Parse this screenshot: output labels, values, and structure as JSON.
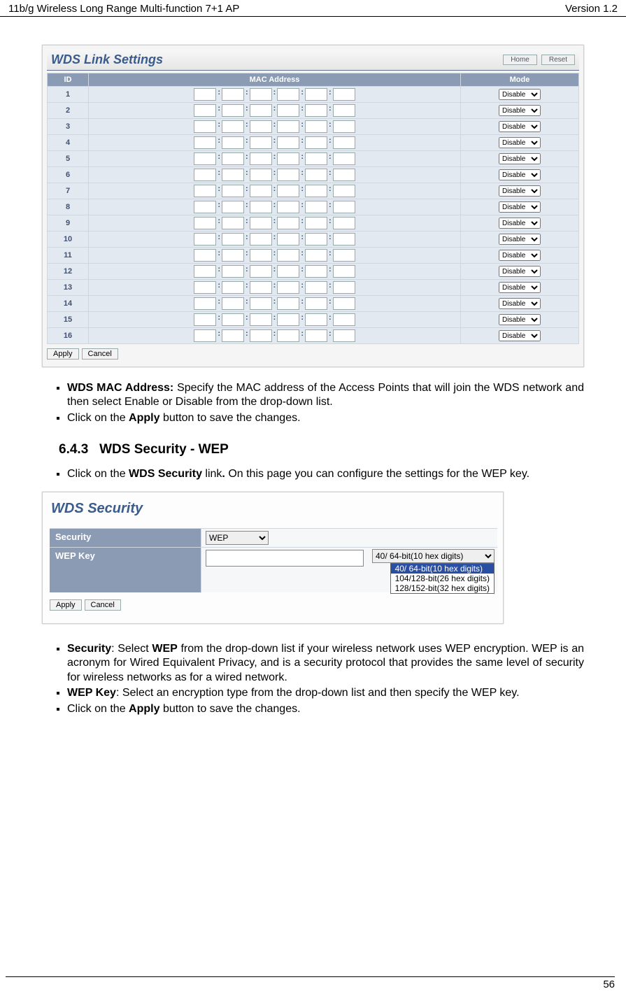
{
  "header": {
    "left": "11b/g Wireless Long Range Multi-function 7+1 AP",
    "right": "Version 1.2"
  },
  "screenshot1": {
    "title": "WDS Link Settings",
    "home": "Home",
    "reset": "Reset",
    "col_id": "ID",
    "col_mac": "MAC Address",
    "col_mode": "Mode",
    "rows": [
      "1",
      "2",
      "3",
      "4",
      "5",
      "6",
      "7",
      "8",
      "9",
      "10",
      "11",
      "12",
      "13",
      "14",
      "15",
      "16"
    ],
    "mode_value": "Disable",
    "apply": "Apply",
    "cancel": "Cancel"
  },
  "bullets1": {
    "item1_bold": "WDS MAC Address:",
    "item1_rest": " Specify the MAC address of the Access Points that will join the WDS network and then select Enable or Disable from the drop-down list.",
    "item2_pre": "Click on the ",
    "item2_bold": "Apply",
    "item2_post": " button to save the changes."
  },
  "section": {
    "num": "6.4.3",
    "title": "WDS Security - WEP"
  },
  "bullets2": {
    "item1_pre": "Click on the ",
    "item1_bold": "WDS Security",
    "item1_mid": " link",
    "item1_dot": ".",
    "item1_post": " On this page you can configure the settings for the WEP key."
  },
  "screenshot2": {
    "title": "WDS Security",
    "row1_label": "Security",
    "row1_value": "WEP",
    "row2_label": "WEP Key",
    "wep_select_value": "40/ 64-bit(10 hex digits)",
    "wep_options": [
      "40/ 64-bit(10 hex digits)",
      "104/128-bit(26 hex digits)",
      "128/152-bit(32 hex digits)"
    ],
    "apply": "Apply",
    "cancel": "Cancel"
  },
  "bullets3": {
    "item1_bold": "Security",
    "item1_colon": ": Select ",
    "item1_bold2": "WEP",
    "item1_rest": " from the drop-down list if your wireless network uses WEP encryption. WEP is an acronym for Wired Equivalent Privacy, and is a security protocol that provides the same level of security for wireless networks as for a wired network.",
    "item2_bold": "WEP Key",
    "item2_rest": ": Select an encryption type from the drop-down list and then specify the WEP key.",
    "item3_pre": "Click on the ",
    "item3_bold": "Apply",
    "item3_post": " button to save the changes."
  },
  "page_number": "56"
}
